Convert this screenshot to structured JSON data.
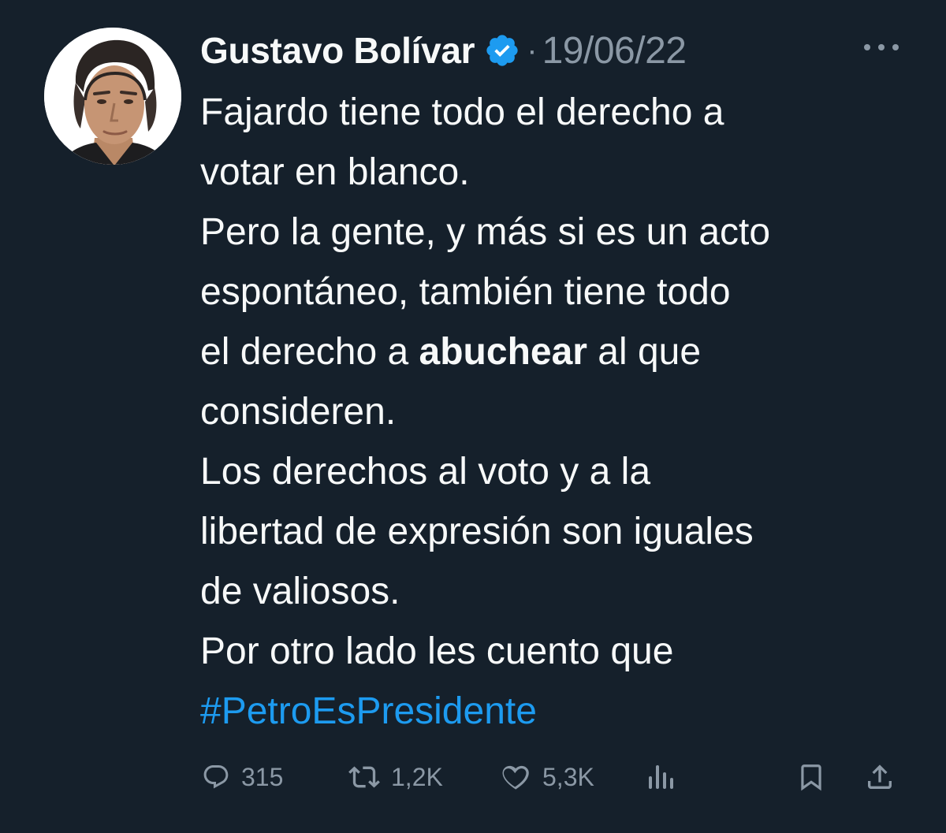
{
  "author": {
    "name": "Gustavo Bolívar",
    "verified": true,
    "separator": "·",
    "date": "19/06/22"
  },
  "tweet": {
    "lines": [
      [
        "Fajardo tiene todo el derecho a"
      ],
      [
        "votar en blanco."
      ],
      [
        "Pero la gente, y más si es un acto"
      ],
      [
        "espontáneo, también tiene todo"
      ],
      [
        "el derecho a ",
        "abuchear",
        " al que"
      ],
      [
        "consideren."
      ],
      [
        "Los derechos al voto y a la"
      ],
      [
        "libertad de expresión son iguales"
      ],
      [
        "de valiosos."
      ],
      [
        "Por otro lado les cuento que"
      ],
      [
        "#PetroEsPresidente"
      ]
    ]
  },
  "actions": {
    "replies": "315",
    "retweets": "1,2K",
    "likes": "5,3K"
  },
  "icons": {
    "verified": "verified-badge-icon",
    "more": "more-options-icon",
    "reply": "reply-icon",
    "retweet": "retweet-icon",
    "like": "heart-icon",
    "views": "views-icon",
    "bookmark": "bookmark-icon",
    "share": "share-icon"
  },
  "colors": {
    "background": "#15202b",
    "text": "#f7f9f9",
    "muted": "#8b98a5",
    "accent": "#1d9bf0"
  }
}
